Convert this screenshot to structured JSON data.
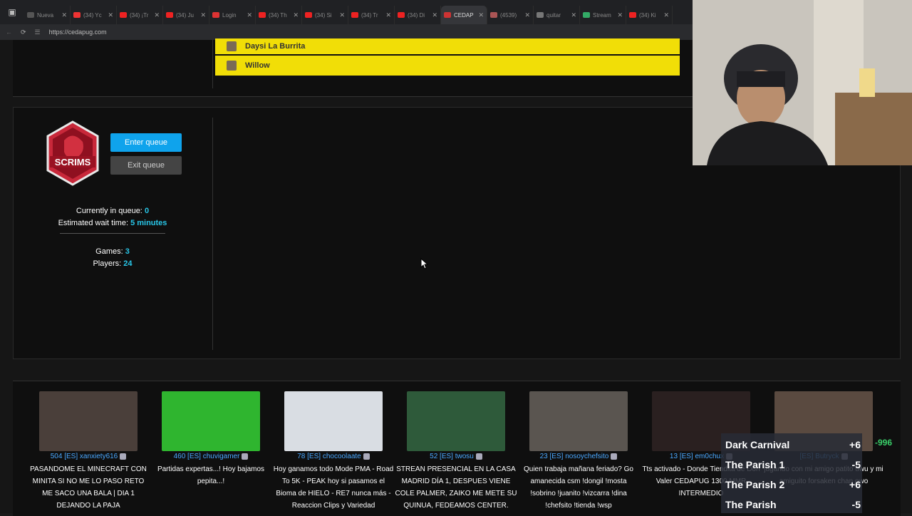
{
  "browser": {
    "tabs": [
      {
        "title": "Nueva",
        "color": "#555"
      },
      {
        "title": "(34) Yc",
        "color": "#e33"
      },
      {
        "title": "(34) ¡Tr",
        "color": "#e22"
      },
      {
        "title": "(34) Ju",
        "color": "#e22"
      },
      {
        "title": "Login",
        "color": "#d33"
      },
      {
        "title": "(34) Th",
        "color": "#e22"
      },
      {
        "title": "(34) Si",
        "color": "#e22"
      },
      {
        "title": "(34) Tr",
        "color": "#e22"
      },
      {
        "title": "(34) Di",
        "color": "#e22"
      },
      {
        "title": "CEDAP",
        "color": "#c33",
        "active": true
      },
      {
        "title": "(4539)",
        "color": "#a55"
      },
      {
        "title": "quitar",
        "color": "#777"
      },
      {
        "title": "Stream",
        "color": "#3a6"
      },
      {
        "title": "(34) Ki",
        "color": "#e22"
      }
    ],
    "url": "https://cedapug.com"
  },
  "top_list": [
    {
      "name": "Daysi La Burrita"
    },
    {
      "name": "Willow"
    }
  ],
  "queue": {
    "badge_text": "SCRIMS",
    "enter_label": "Enter queue",
    "exit_label": "Exit queue",
    "currently_label": "Currently in queue:",
    "currently_value": "0",
    "wait_label": "Estimated wait time:",
    "wait_value": "5 minutes",
    "games_label": "Games:",
    "games_value": "3",
    "players_label": "Players:",
    "players_value": "24"
  },
  "streams": [
    {
      "viewers": "504",
      "name": "[ES] xanxiety616",
      "desc": "PASANDOME EL MINECRAFT CON MINITA SI NO ME LO PASO RETO ME SACO UNA BALA | DIA 1 DEJANDO LA PAJA",
      "thumb": "#4a3f3a"
    },
    {
      "viewers": "460",
      "name": "[ES] chuvigamer",
      "desc": "Partidas expertas...! Hoy bajamos pepita...!",
      "thumb": "#2fb52f"
    },
    {
      "viewers": "78",
      "name": "[ES] chocoolaate",
      "desc": "Hoy ganamos todo Mode PMA - Road To 5K - PEAK hoy si pasamos el Bioma de HIELO - RE7 nunca más - Reaccion Clips y Variedad",
      "thumb": "#d9dde3"
    },
    {
      "viewers": "52",
      "name": "[ES] twosu",
      "desc": "STREAN PRESENCIAL EN LA CASA MADRID DÍA 1, DESPUES VIENE COLE PALMER, ZAIKO ME METE SU QUINUA, FEDEAMOS CENTER.",
      "thumb": "#2e5a3a"
    },
    {
      "viewers": "23",
      "name": "[ES] nosoychefsito",
      "desc": "Quien trabaja mañana feriado? Go amanecida csm !dongil !mosta !sobrino !juanito !vizcarra !dina !chefsito !tienda !wsp",
      "thumb": "#5a5550"
    },
    {
      "viewers": "13",
      "name": "[ES] em0chux",
      "desc": "Tts activado - Donde Tiendita de Don Valer CEDAPUG 1300 MMR INTERMEDIO",
      "thumb": "#2a2020"
    },
    {
      "viewers": "",
      "name": "[ES] Butryck",
      "desc": "jugando con mi amigo patito uwu y mi amiguito forsaken chan owo",
      "thumb": "#5a4a40"
    }
  ],
  "overlay": {
    "rows": [
      {
        "name": "Dark Carnival",
        "score": "+6"
      },
      {
        "name": "The Parish 1",
        "score": "-5"
      },
      {
        "name": "The Parish 2",
        "score": "+6"
      },
      {
        "name": "The Parish",
        "score": "-5"
      }
    ],
    "mmr": "-996"
  }
}
